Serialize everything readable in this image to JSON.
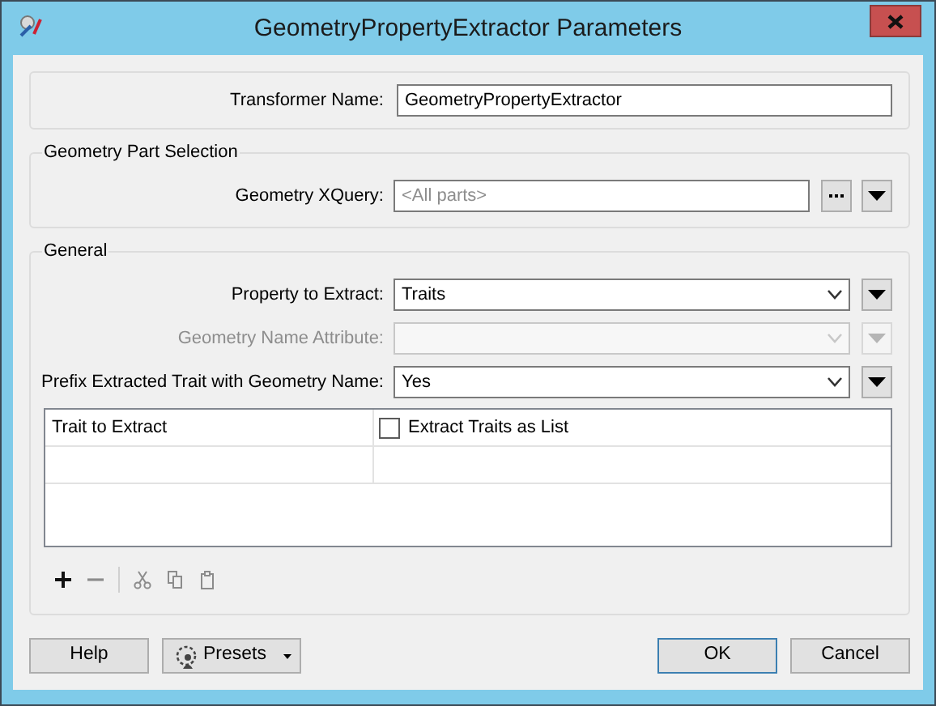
{
  "window": {
    "title": "GeometryPropertyExtractor Parameters"
  },
  "transformer_name": {
    "label": "Transformer Name:",
    "value": "GeometryPropertyExtractor"
  },
  "geometry_part_selection": {
    "title": "Geometry Part Selection",
    "xquery": {
      "label": "Geometry XQuery:",
      "placeholder": "<All parts>"
    }
  },
  "general": {
    "title": "General",
    "fields": [
      {
        "label": "Property to Extract:",
        "value": "Traits",
        "disabled": false
      },
      {
        "label": "Geometry Name Attribute:",
        "disabled": true
      },
      {
        "label": "Prefix Extracted Trait with Geometry Name:",
        "value": "Yes",
        "disabled": false
      }
    ],
    "table": {
      "columns": [
        {
          "label": "Trait to Extract",
          "kind": "text"
        },
        {
          "label": "Extract Traits as List",
          "kind": "checkbox",
          "checked": false
        }
      ]
    },
    "toolbar": [
      {
        "kind": "add",
        "disabled": false
      },
      {
        "kind": "remove",
        "disabled": true
      },
      {
        "kind": "separator"
      },
      {
        "kind": "cut",
        "disabled": true
      },
      {
        "kind": "copy",
        "disabled": true
      },
      {
        "kind": "paste",
        "disabled": true
      }
    ]
  },
  "buttons": [
    {
      "label": "Help",
      "kind": "plain",
      "default": false
    },
    {
      "label": "Presets",
      "kind": "menu",
      "default": false
    },
    {
      "label": "OK",
      "kind": "plain",
      "default": true
    },
    {
      "label": "Cancel",
      "kind": "plain",
      "default": false
    }
  ]
}
